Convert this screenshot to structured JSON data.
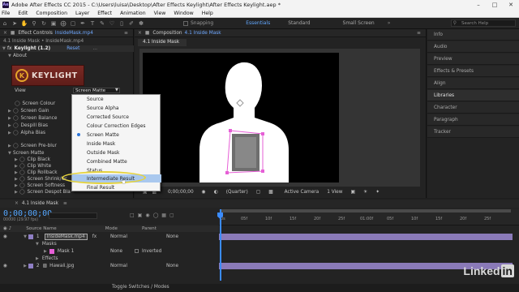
{
  "window": {
    "title": "Adobe After Effects CC 2015 - C:\\Users\\luisa\\Desktop\\After Effects Keylight\\After Effects Keylight.aep *",
    "logo": "Ae"
  },
  "menu": [
    "File",
    "Edit",
    "Composition",
    "Layer",
    "Effect",
    "Animation",
    "View",
    "Window",
    "Help"
  ],
  "toolbar": {
    "snapping": "Snapping",
    "workspaces": [
      "Essentials",
      "Standard",
      "Small Screen"
    ],
    "active_workspace": "Essentials",
    "search_placeholder": "Search Help"
  },
  "effect_controls": {
    "tab": "Effect Controls",
    "tab_layer": "InsideMask.mp4",
    "path": "4.1 Inside Mask • InsideMask.mp4",
    "effect_name": "Keylight (1.2)",
    "reset": "Reset",
    "about": "About",
    "banner_text": "KEYLIGHT",
    "banner_logo": "K",
    "view_label": "View",
    "view_value": "Screen Matte",
    "rows": [
      "Screen Colour",
      "Screen Gain",
      "Screen Balance",
      "Despill Bias",
      "Alpha Bias",
      "Screen Pre-blur",
      "Screen Matte",
      "Clip Black",
      "Clip White",
      "Clip Rollback",
      "Screen Shrink/Gr",
      "Screen Softness",
      "Screen Despot Bla"
    ]
  },
  "view_dropdown": {
    "options": [
      "Source",
      "Source Alpha",
      "Corrected Source",
      "Colour Correction Edges",
      "Screen Matte",
      "Inside Mask",
      "Outside Mask",
      "Combined Matte",
      "Status",
      "Intermediate Result",
      "Final Result"
    ],
    "selected": "Screen Matte",
    "hovered": "Intermediate Result"
  },
  "composition": {
    "panel_title": "Composition",
    "panel_link": "4.1 Inside Mask",
    "tab": "4.1 Inside Mask",
    "zoom": "(Quarter)",
    "timecode": "0;00;00;00",
    "camera": "Active Camera",
    "views": "1 View"
  },
  "right_panels": [
    "Info",
    "Audio",
    "Preview",
    "Effects & Presets",
    "Align",
    "Libraries",
    "Character",
    "Paragraph",
    "Tracker"
  ],
  "active_right_panel": "Libraries",
  "timeline": {
    "tab": "4.1 Inside Mask",
    "timecode": "0;00;00;00",
    "fps": "00000 (29.97 fps)",
    "columns": {
      "source": "Source Name",
      "mode": "Mode",
      "parent": "Parent"
    },
    "layers": [
      {
        "num": "1",
        "name": "InsideMask.mp4",
        "mode": "Normal",
        "parent": "None"
      },
      {
        "num": "",
        "name": "Masks",
        "mode": "",
        "parent": ""
      },
      {
        "num": "",
        "name": "Mask 1",
        "mode": "None",
        "parent": "Inverted"
      },
      {
        "num": "",
        "name": "Effects",
        "mode": "",
        "parent": ""
      },
      {
        "num": "2",
        "name": "Hawaii.jpg",
        "mode": "Normal",
        "parent": "None"
      }
    ],
    "ruler_ticks": [
      "0s",
      "05f",
      "10f",
      "15f",
      "20f",
      "25f",
      "01:00f",
      "05f",
      "10f",
      "15f",
      "20f",
      "25f"
    ],
    "footer": "Toggle Switches / Modes"
  },
  "watermark": {
    "text": "Linked",
    "box": "in"
  },
  "colors": {
    "accent_blue": "#3b8cff",
    "keylight_red": "#7b2a24",
    "highlight_yellow": "#e6d33d",
    "layer_purple": "#8f7fc5"
  }
}
